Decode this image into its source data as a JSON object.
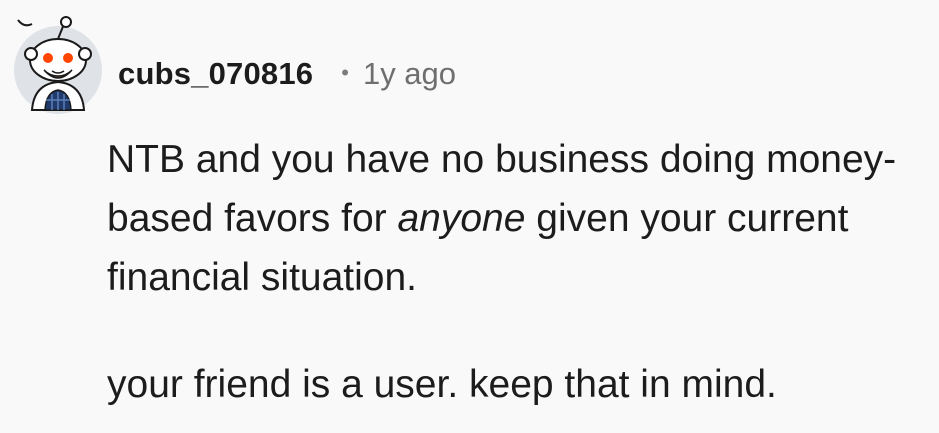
{
  "comment": {
    "author": "cubs_070816",
    "separator": "•",
    "timestamp": "1y ago",
    "avatar_icon": "snoo-avatar-icon",
    "paragraphs": [
      {
        "before": "NTB and you have no business doing money-based favors for ",
        "emphasis": "anyone",
        "after": " given your current financial situation."
      },
      {
        "text": "your friend is a user. keep that in mind."
      }
    ]
  },
  "colors": {
    "background": "#f9f9f9",
    "text": "#1c1c1c",
    "meta": "#6f6f6f",
    "avatar_eye": "#ff4500",
    "avatar_shirt": "#1f3a6b"
  }
}
